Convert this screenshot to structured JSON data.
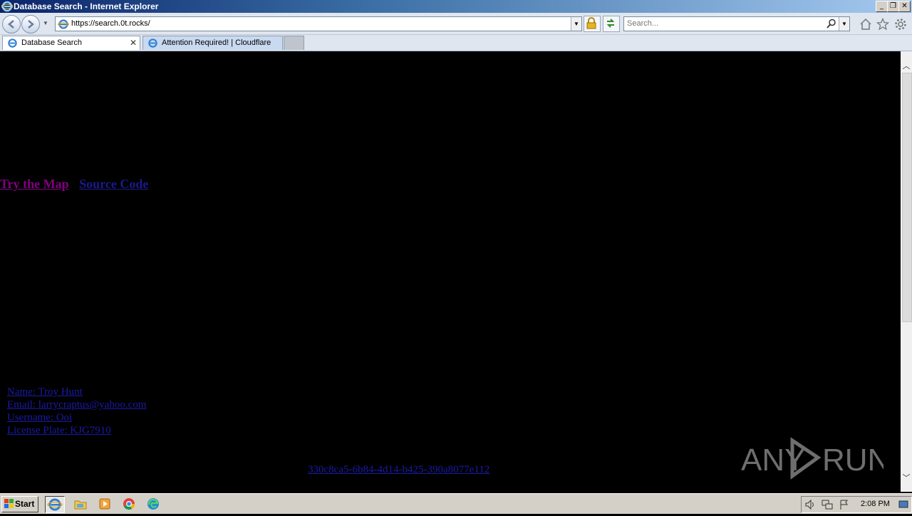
{
  "window": {
    "title": "Database Search - Internet Explorer",
    "min_glyph": "_",
    "restore_glyph": "❐",
    "close_glyph": "✕"
  },
  "nav": {
    "url": "https://search.0t.rocks/",
    "search_placeholder": "Search..."
  },
  "tabs": [
    {
      "label": "Database Search",
      "active": true
    },
    {
      "label": "Attention Required! | Cloudflare",
      "active": false
    }
  ],
  "page": {
    "links": [
      {
        "label": "Try the Map"
      },
      {
        "label": "Source Code"
      }
    ],
    "result": {
      "name": "Name: Troy Hunt",
      "email": "Email: larrycraptus@yahoo.com",
      "username": "Username: Ooi",
      "license_plate": "License Plate: KJG7910"
    },
    "uuid": "330c8ca5-6b84-4d14-b425-390a8077e112"
  },
  "watermark": {
    "text": "ANY RUN"
  },
  "taskbar": {
    "start_label": "Start",
    "clock": "2:08 PM"
  },
  "colors": {
    "page_bg": "#000000",
    "visited_link": "#800080",
    "link": "#1a1aa6"
  }
}
